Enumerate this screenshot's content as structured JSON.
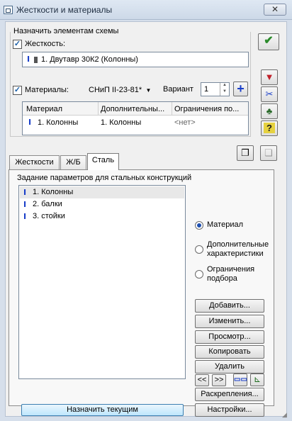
{
  "window": {
    "title": "Жесткости и материалы",
    "close": "✕"
  },
  "assign": {
    "group_label": "Назначить элементам схемы",
    "stiffness_label": "Жесткость:",
    "stiffness_value": "1. Двутавр 30К2 (Колонны)",
    "materials_label": "Материалы:",
    "norm_value": "СНиП II-23-81*",
    "variant_label": "Вариант",
    "variant_value": "1",
    "table": {
      "headers": [
        "Материал",
        "Дополнительны...",
        "Ограничения по..."
      ],
      "rows": [
        [
          "1. Колонны",
          "1. Колонны",
          "<нет>"
        ]
      ]
    }
  },
  "tabs": [
    "Жесткости",
    "Ж/Б",
    "Сталь"
  ],
  "active_tab": "Сталь",
  "steel": {
    "group_label": "Задание параметров для стальных конструкций",
    "items": [
      "1. Колонны",
      "2. балки",
      "3. стойки"
    ],
    "radios": [
      "Материал",
      "Дополнительные характеристики",
      "Ограничения подбора"
    ],
    "selected_radio": "Материал",
    "buttons": {
      "add": "Добавить...",
      "edit": "Изменить...",
      "view": "Просмотр...",
      "copy": "Копировать",
      "delete": "Удалить",
      "prev": "<<",
      "next": ">>",
      "bracing": "Раскрепления...",
      "settings": "Настройки..."
    },
    "assign_current": "Назначить текущим"
  },
  "colors": {
    "accent": "#1a3fc9",
    "selection": "#e8e8e8"
  }
}
